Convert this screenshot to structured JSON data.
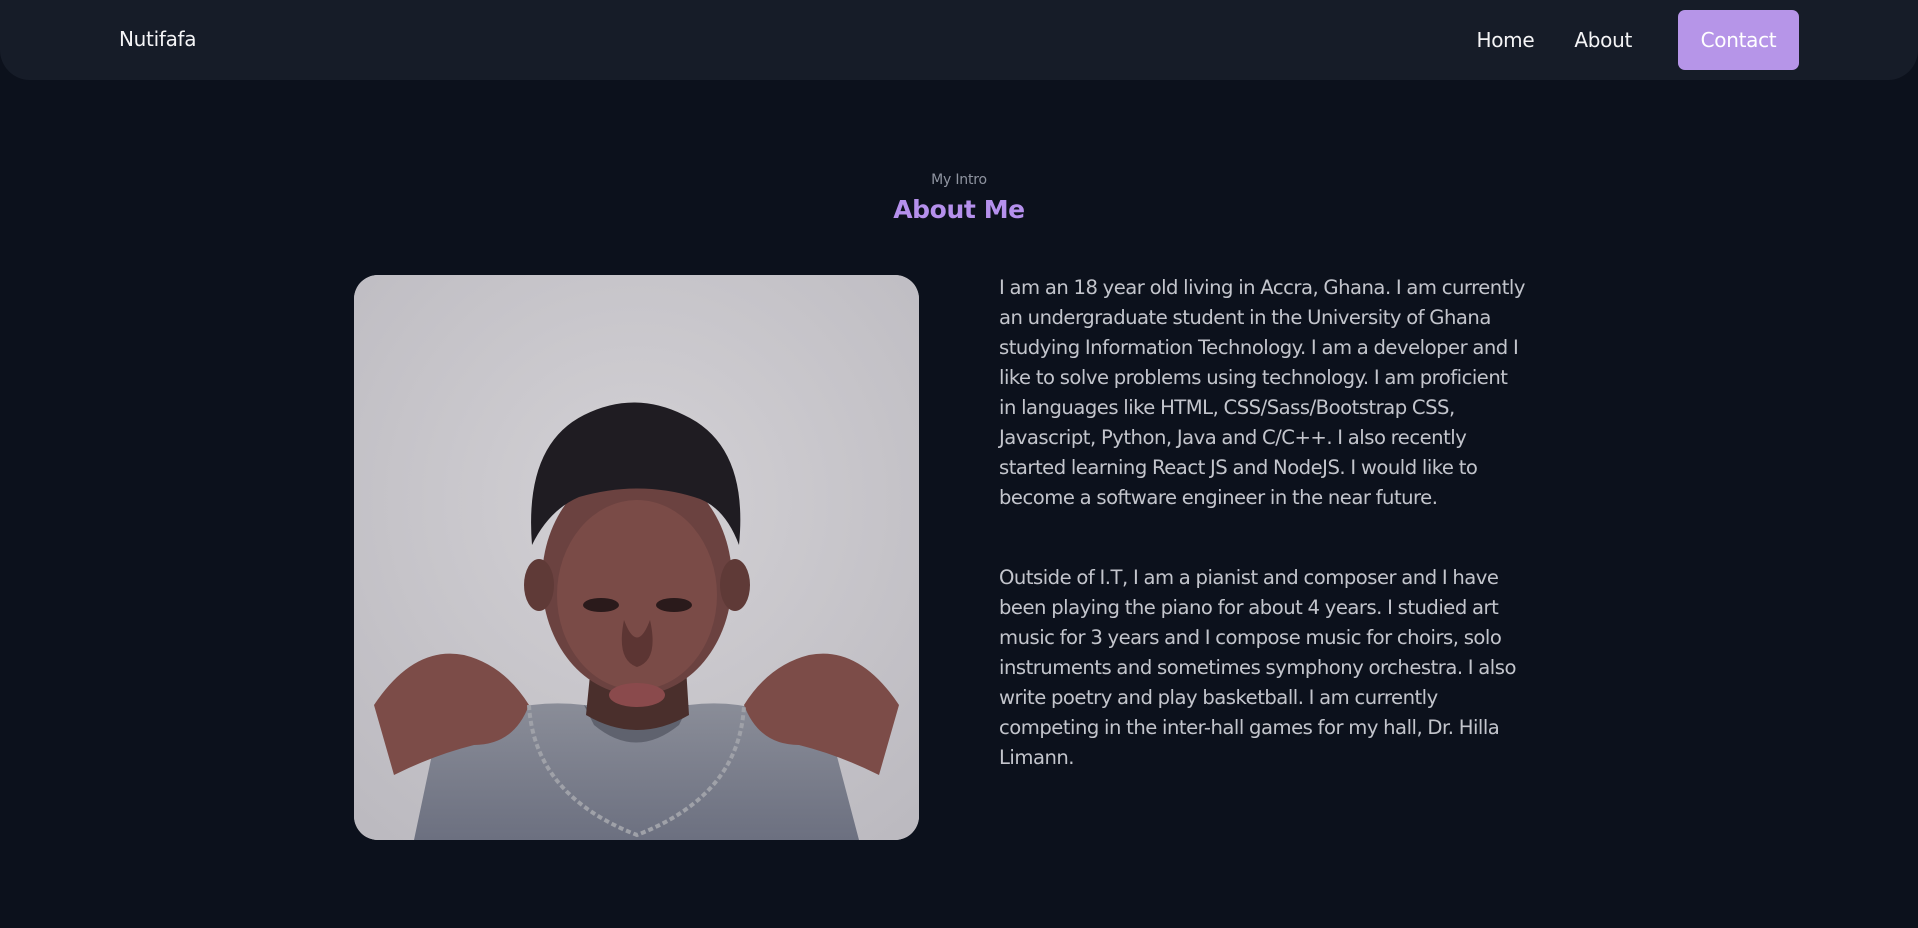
{
  "nav": {
    "logo": "Nutifafa",
    "links": [
      {
        "label": "Home"
      },
      {
        "label": "About"
      }
    ],
    "contact_label": "Contact"
  },
  "about": {
    "subtitle": "My Intro",
    "title": "About Me",
    "photo_icon": "portrait-photo",
    "paragraphs": [
      "I am an 18 year old living in Accra, Ghana. I am currently an undergraduate student in the University of Ghana studying Information Technology. I am a developer and I like to solve problems using technology. I am proficient in languages like HTML, CSS/Sass/Bootstrap CSS, Javascript, Python, Java and C/C++. I also recently started learning React JS and NodeJS. I would like to become a software engineer in the near future.",
      "Outside of I.T, I am a pianist and composer and I have been playing the piano for about 4 years. I studied art music for 3 years and I compose music for choirs, solo instruments and sometimes symphony orchestra. I also write poetry and play basketball. I am currently competing in the inter-hall games for my hall, Dr. Hilla Limann."
    ]
  },
  "colors": {
    "background": "#0c111c",
    "navbar": "#161c28",
    "accent": "#b695e8",
    "title": "#b590ec",
    "body_text": "#c3c5cc",
    "muted_text": "#8f94a0"
  }
}
